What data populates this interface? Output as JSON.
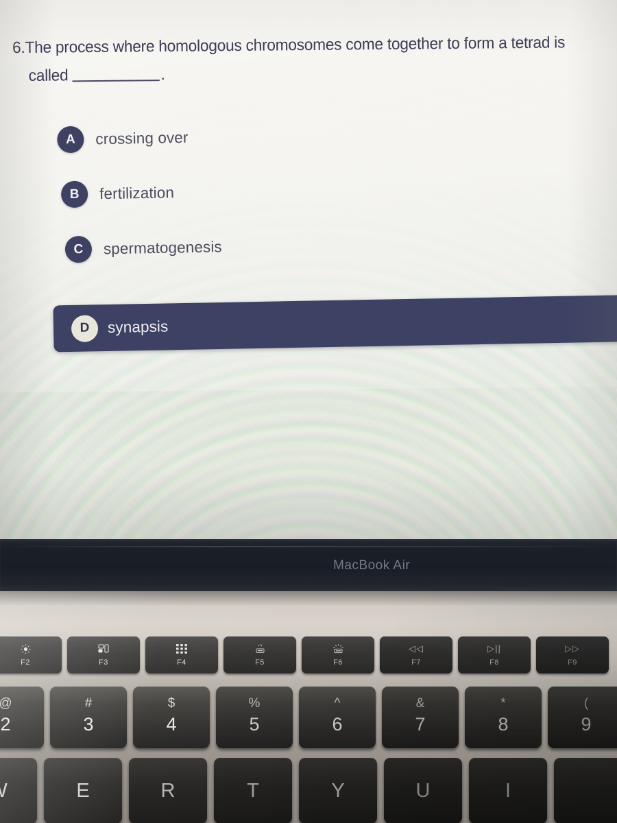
{
  "quiz": {
    "question_number": "6.",
    "question_line1": "The process where homologous chromosomes come together to form a tetrad is",
    "question_line2_prefix": "called",
    "question_line2_suffix": ".",
    "options": [
      {
        "letter": "A",
        "label": "crossing over",
        "selected": false
      },
      {
        "letter": "B",
        "label": "fertilization",
        "selected": false
      },
      {
        "letter": "C",
        "label": "spermatogenesis",
        "selected": false
      },
      {
        "letter": "D",
        "label": "synapsis",
        "selected": true
      }
    ],
    "colors": {
      "badge": "#3f4163",
      "selected_row": "#3d4264",
      "selected_badge": "#e9e7dc",
      "question_text": "#3b3a54",
      "option_text": "#4d4c5e",
      "card_background": "#f1efe8"
    }
  },
  "laptop": {
    "bezel_label": "MacBook Air",
    "bezel_color": "#1b1f27",
    "body_color": "#c5bfb8",
    "function_keys": [
      {
        "name": "F2",
        "icon": "brightness-up-icon"
      },
      {
        "name": "F3",
        "icon": "mission-control-icon"
      },
      {
        "name": "F4",
        "icon": "launchpad-icon"
      },
      {
        "name": "F5",
        "icon": "keyboard-backlight-down-icon"
      },
      {
        "name": "F6",
        "icon": "keyboard-backlight-up-icon"
      },
      {
        "name": "F7",
        "icon": "rewind-icon",
        "glyph": "◁◁"
      },
      {
        "name": "F8",
        "icon": "play-pause-icon",
        "glyph": "▷||"
      },
      {
        "name": "F9",
        "icon": "fast-forward-icon",
        "glyph": "▷▷"
      }
    ],
    "number_keys": [
      {
        "symbol": "@",
        "digit": "2"
      },
      {
        "symbol": "#",
        "digit": "3"
      },
      {
        "symbol": "$",
        "digit": "4"
      },
      {
        "symbol": "%",
        "digit": "5"
      },
      {
        "symbol": "^",
        "digit": "6"
      },
      {
        "symbol": "&",
        "digit": "7"
      },
      {
        "symbol": "*",
        "digit": "8"
      },
      {
        "symbol": "(",
        "digit": "9"
      }
    ],
    "letter_keys": [
      "W",
      "E",
      "R",
      "T",
      "Y",
      "U",
      "I"
    ]
  }
}
